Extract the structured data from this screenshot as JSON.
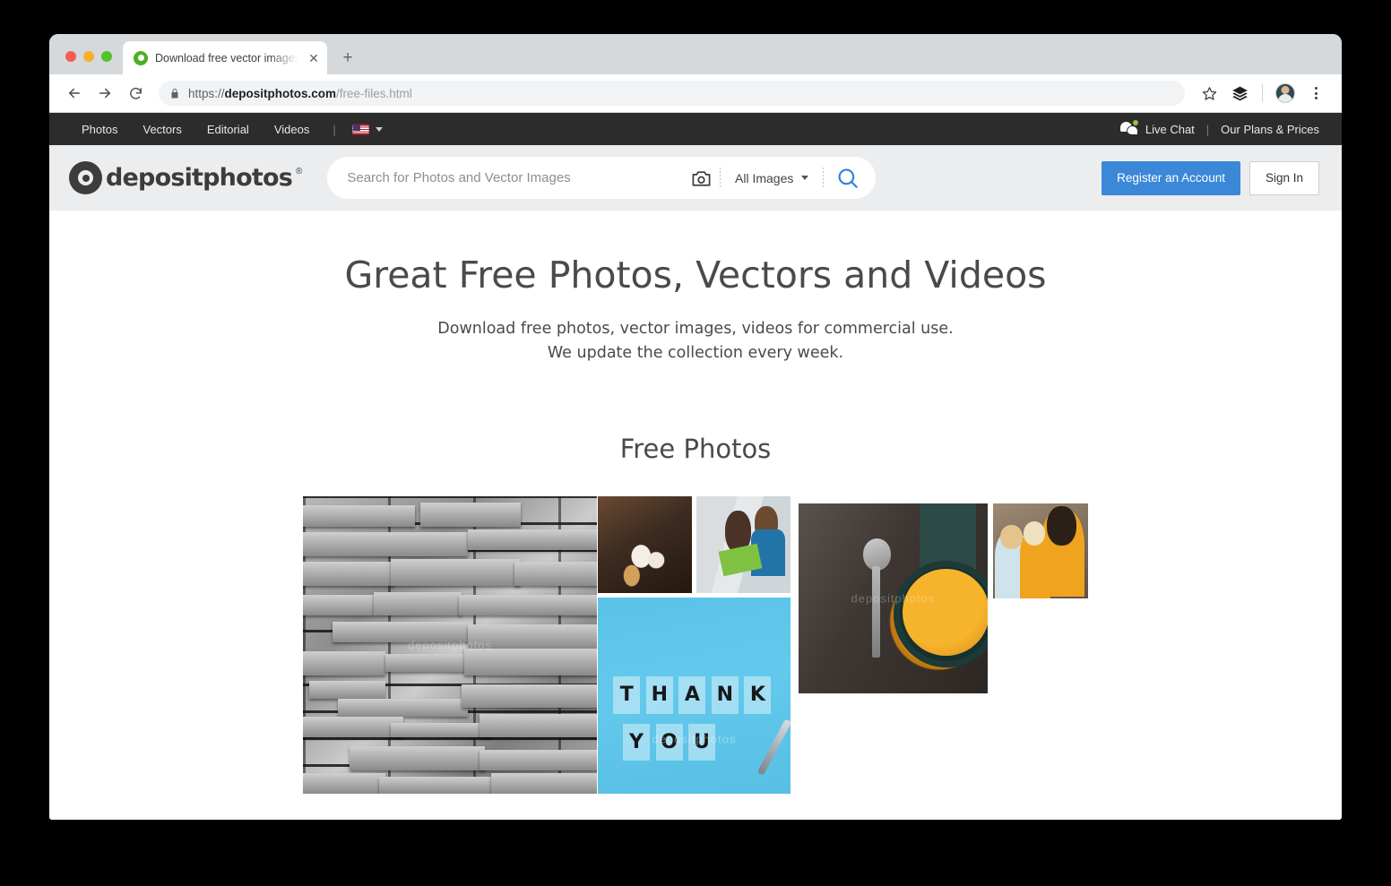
{
  "browser": {
    "tab": {
      "title": "Download free vector images a",
      "favicon": "depositphotos-camera-favicon",
      "close_label": "✕",
      "new_tab_label": "+"
    },
    "toolbar": {
      "back_label": "back-arrow",
      "forward_label": "forward-arrow",
      "reload_label": "reload",
      "lock_label": "secure-lock",
      "url_scheme": "https://",
      "url_domain": "depositphotos.com",
      "url_path": "/free-files.html",
      "bookmark_label": "star",
      "extensions_label": "layers",
      "profile_label": "user-avatar",
      "menu_label": "three-dot-menu"
    }
  },
  "topnav": {
    "links": [
      "Photos",
      "Vectors",
      "Editorial",
      "Videos"
    ],
    "separator": "|",
    "language": {
      "flag": "us-flag",
      "caret": "chevron-down"
    },
    "live_chat": "Live Chat",
    "right_separator": "|",
    "plans": "Our Plans & Prices"
  },
  "header": {
    "logo_word": "depositphotos",
    "logo_reg": "®",
    "search": {
      "placeholder": "Search for Photos and Vector Images",
      "value": "",
      "camera_icon": "camera-search-icon",
      "type_label": "All Images",
      "submit_icon": "magnifier-icon"
    },
    "register_label": "Register an Account",
    "signin_label": "Sign In",
    "accent_color": "#3b87d8"
  },
  "hero": {
    "title": "Great Free Photos, Vectors and Videos",
    "subtitle_line1": "Download free photos, vector images, videos for commercial use.",
    "subtitle_line2": "We update the collection every week."
  },
  "section": {
    "title": "Free Photos"
  },
  "gallery": {
    "watermark": "depositphotos",
    "tiles": [
      {
        "name": "stone-brick-wall-photo",
        "alt": "Grayscale stacked stone brick wall"
      },
      {
        "name": "coffee-tray-photo",
        "alt": "Coffee pitcher, cup and dessert on a tray"
      },
      {
        "name": "kids-painting-photo",
        "alt": "Girl holding green paper with boy in blue"
      },
      {
        "name": "thank-you-note-photo",
        "alt": "THANK YOU letter tiles on blue background with pen"
      },
      {
        "name": "pumpkin-soup-photo",
        "alt": "Bowl of pumpkin soup with spoon on dark table"
      },
      {
        "name": "family-portrait-photo",
        "alt": "Bearded man holding two children outdoors"
      }
    ],
    "thank_you_row1": [
      "T",
      "H",
      "A",
      "N",
      "K"
    ],
    "thank_you_row2": [
      "Y",
      "O",
      "U"
    ]
  }
}
